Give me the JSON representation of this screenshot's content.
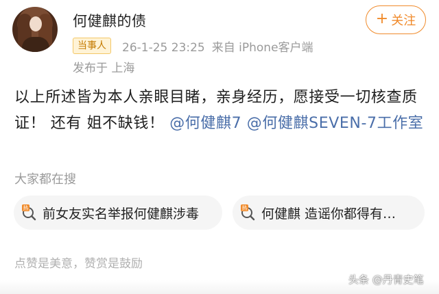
{
  "post": {
    "username": "何健麒的债",
    "follow_label": "关注",
    "follow_plus": "+",
    "badge": "当事人",
    "timestamp": "26-1-25 23:25",
    "source": "来自 iPhone客户端",
    "location": "发布于 上海",
    "text_main": "以上所述皆为本人亲眼目睹，亲身经历，愿接受一切核查质证！ 还有 姐不缺钱！",
    "mention1": "@何健麒7",
    "mention2": "@何健麒SEVEN-7工作室"
  },
  "trending": {
    "title": "大家都在搜",
    "items": [
      {
        "label": "前女友实名举报何健麒涉毒"
      },
      {
        "label": "何健麒 造谣你都得有…"
      }
    ]
  },
  "footer": {
    "note": "点赞是美意，赞赏是鼓励",
    "watermark": "头条 @丹青史笔"
  },
  "colors": {
    "accent": "#f08a2a",
    "mention": "#4a6ea9",
    "muted": "#9a9a9a"
  },
  "icons": [
    "avatar",
    "plus-icon",
    "hot-search-icon"
  ]
}
